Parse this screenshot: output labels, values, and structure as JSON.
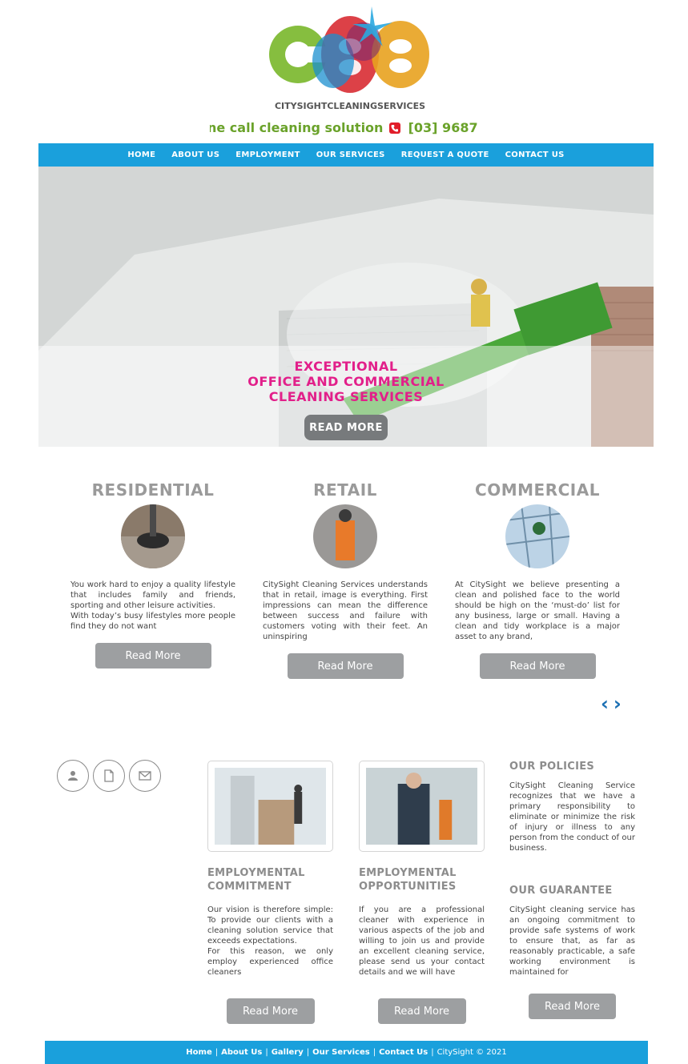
{
  "header": {
    "logo_text": "CITYSIGHTCLEANINGSERVICES",
    "tagline": "one call cleaning solution",
    "phone": "[03] 9687"
  },
  "nav": {
    "items": [
      "HOME",
      "ABOUT US",
      "EMPLOYMENT",
      "OUR SERVICES",
      "REQUEST A QUOTE",
      "CONTACT US"
    ]
  },
  "hero": {
    "line1": "EXCEPTIONAL",
    "line2": "OFFICE AND COMMERCIAL",
    "line3": "CLEANING SERVICES",
    "cta": "READ MORE"
  },
  "services": [
    {
      "title": "RESIDENTIAL",
      "text1": "You work hard to enjoy a quality lifestyle that includes family and friends, sporting and other leisure activities.",
      "text2": "With today’s busy lifestyles more people find they do not want",
      "button": "Read More"
    },
    {
      "title": "RETAIL",
      "text1": "CitySight Cleaning Services understands that in retail, image is everything. First impressions can mean the difference between success and failure with customers voting with their feet. An uninspiring",
      "text2": "",
      "button": "Read More"
    },
    {
      "title": "COMMERCIAL",
      "text1": "At CitySight we believe presenting a clean and polished face to the world should be high on the ‘must-do’ list for any business, large or small. Having a clean and tidy workplace is a major asset to any brand,",
      "text2": "",
      "button": "Read More"
    }
  ],
  "carousel": {
    "prev": "‹",
    "next": "›"
  },
  "employment": [
    {
      "title": "EMPLOYMENTAL COMMITMENT",
      "text1": "Our vision is therefore simple: To provide our clients with a cleaning solution service that exceeds expectations.",
      "text2": "For this reason, we only employ experienced office cleaners",
      "button": "Read More"
    },
    {
      "title": "EMPLOYMENTAL OPPORTUNITIES",
      "text1": "If you are a professional cleaner with experience in various aspects of the job and willing to join us and provide an excellent cleaning service, please send us your contact details and we will have",
      "text2": "",
      "button": "Read More"
    }
  ],
  "policies": {
    "policy_title": "OUR POLICIES",
    "policy_text": "CitySight Cleaning Service recognizes that we have a primary responsibility to eliminate or minimize the risk of injury or illness to any person from the conduct of our business.",
    "guarantee_title": "OUR GUARANTEE",
    "guarantee_text": "CitySight cleaning service has an ongoing commitment to provide safe systems of work to ensure that, as far as reasonably practicable, a safe working environment is maintained for",
    "button": "Read More"
  },
  "footer": {
    "links": [
      "Home",
      "About Us",
      "Gallery",
      "Our Services",
      "Contact Us"
    ],
    "sep": "|",
    "copyright": "CitySight © 2021"
  },
  "colors": {
    "nav_bg": "#1aa0dc",
    "hero_headline": "#e21f8a",
    "tagline": "#6aa22a",
    "button_grey": "#9d9fa1",
    "heading_grey": "#9a9a9a"
  }
}
